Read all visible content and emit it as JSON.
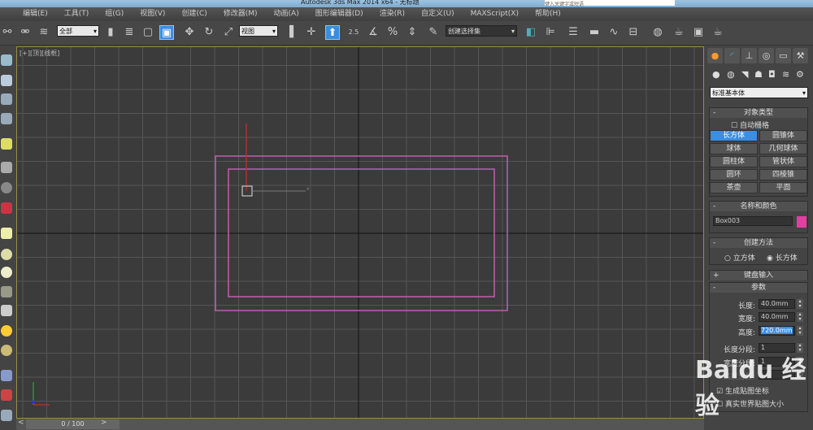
{
  "titlebar": {
    "title": "Autodesk 3ds Max 2014 x64 - 无标题",
    "search_placeholder": "键入关键字或短语"
  },
  "menu": [
    "编辑(E)",
    "工具(T)",
    "组(G)",
    "视图(V)",
    "创建(C)",
    "修改器(M)",
    "动画(A)",
    "图形编辑器(D)",
    "渲染(R)",
    "自定义(U)",
    "MAXScript(X)",
    "帮助(H)"
  ],
  "toolbar": {
    "selection_filter": "全部",
    "reference_coord": "视图",
    "named_selection": "创建选择集",
    "snap_angle": "2.5",
    "snap_percent": "%"
  },
  "viewport": {
    "label": "[+][顶][线框]",
    "axis_y": "y",
    "axis_x": "x",
    "object_color": "#c060b0"
  },
  "timeline": {
    "frame": "0 / 100"
  },
  "panel": {
    "category": "标准基本体",
    "object_type": {
      "title": "对象类型",
      "autogrid": "自动栅格",
      "buttons": [
        "长方体",
        "圆锥体",
        "球体",
        "几何球体",
        "圆柱体",
        "管状体",
        "圆环",
        "四棱锥",
        "茶壶",
        "平面"
      ],
      "selected": "长方体"
    },
    "name_color": {
      "title": "名称和颜色",
      "name": "Box003",
      "color": "#e040a0"
    },
    "creation": {
      "title": "创建方法",
      "options": [
        "立方体",
        "长方体"
      ],
      "selected": "长方体"
    },
    "keyboard": {
      "title": "键盘输入"
    },
    "params": {
      "title": "参数",
      "fields": [
        {
          "label": "长度:",
          "value": "40.0mm"
        },
        {
          "label": "宽度:",
          "value": "40.0mm"
        },
        {
          "label": "高度:",
          "value": "720.0mm"
        },
        {
          "label": "长度分段:",
          "value": "1"
        },
        {
          "label": "宽度分段:",
          "value": "1"
        },
        {
          "label": "高度分段:",
          "value": "1"
        }
      ],
      "gen_mapping": "生成贴图坐标",
      "real_world": "真实世界贴图大小"
    }
  },
  "watermark": "Baidu 经验"
}
